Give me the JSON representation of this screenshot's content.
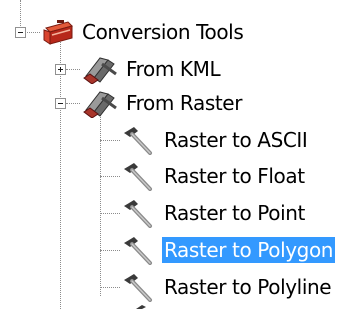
{
  "tree": {
    "root": {
      "label": "Conversion Tools",
      "icon": "red-toolbox-icon",
      "expanded": true
    },
    "toolsets": [
      {
        "label": "From KML",
        "icon": "toolset-icon",
        "expanded": false
      },
      {
        "label": "From Raster",
        "icon": "toolset-icon",
        "expanded": true
      }
    ],
    "tools": [
      {
        "label": "Raster to ASCII",
        "icon": "hammer-icon",
        "selected": false
      },
      {
        "label": "Raster to Float",
        "icon": "hammer-icon",
        "selected": false
      },
      {
        "label": "Raster to Point",
        "icon": "hammer-icon",
        "selected": false
      },
      {
        "label": "Raster to Polygon",
        "icon": "hammer-icon",
        "selected": true
      },
      {
        "label": "Raster to Polyline",
        "icon": "hammer-icon",
        "selected": false
      }
    ]
  },
  "colors": {
    "selection": "#3399ff",
    "selection_text": "#ffffff",
    "tree_lines": "#8c8c8c",
    "toolbox_red": "#c0392b"
  }
}
